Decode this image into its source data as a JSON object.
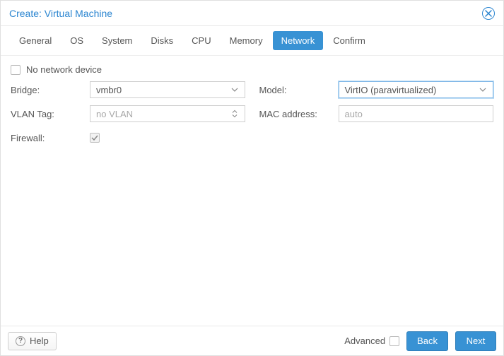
{
  "window": {
    "title": "Create: Virtual Machine"
  },
  "tabs": {
    "general": "General",
    "os": "OS",
    "system": "System",
    "disks": "Disks",
    "cpu": "CPU",
    "memory": "Memory",
    "network": "Network",
    "confirm": "Confirm"
  },
  "net": {
    "noDevice": "No network device",
    "bridgeLabel": "Bridge:",
    "bridgeValue": "vmbr0",
    "vlanLabel": "VLAN Tag:",
    "vlanPlaceholder": "no VLAN",
    "firewallLabel": "Firewall:",
    "modelLabel": "Model:",
    "modelValue": "VirtIO (paravirtualized)",
    "macLabel": "MAC address:",
    "macPlaceholder": "auto"
  },
  "footer": {
    "help": "Help",
    "advanced": "Advanced",
    "back": "Back",
    "next": "Next"
  }
}
